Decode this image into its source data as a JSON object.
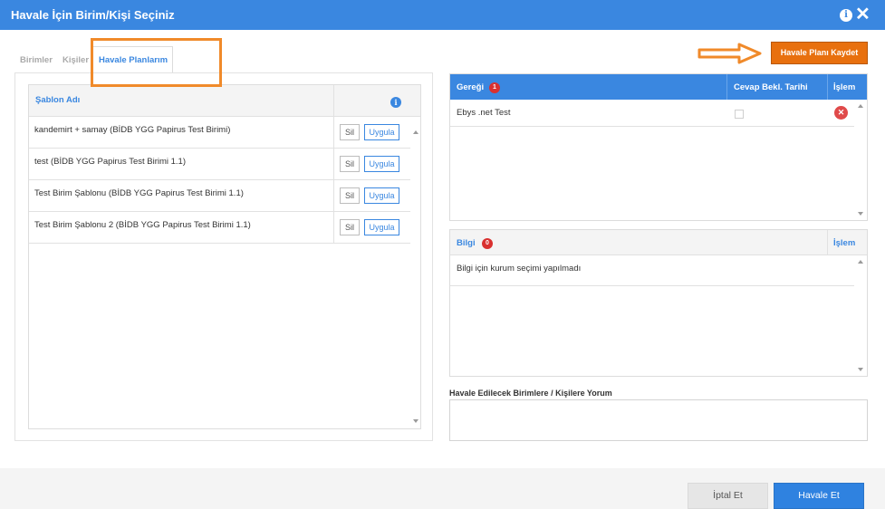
{
  "dialog": {
    "title": "Havale İçin Birim/Kişi Seçiniz",
    "info_icon": "i",
    "close_icon": "✕"
  },
  "tabs": [
    {
      "label": "Birimler",
      "active": false
    },
    {
      "label": "Kişiler",
      "active": false
    },
    {
      "label": "Havale Planlarım",
      "active": true
    }
  ],
  "templates": {
    "header": "Şablon Adı",
    "info_icon": "i",
    "delete_label": "Sil",
    "apply_label": "Uygula",
    "rows": [
      {
        "name": "kandemirt + samay (BİDB YGG Papirus Test Birimi)"
      },
      {
        "name": "test (BİDB YGG Papirus Test Birimi 1.1)"
      },
      {
        "name": "Test Birim Şablonu (BİDB YGG Papirus Test Birimi 1.1)"
      },
      {
        "name": "Test Birim Şablonu 2 (BİDB YGG Papirus Test Birimi 1.1)"
      }
    ]
  },
  "save_plan_button": "Havale Planı Kaydet",
  "geregi": {
    "title": "Gereği",
    "count": "1",
    "col_date": "Cevap Bekl. Tarihi",
    "col_action": "İşlem",
    "rows": [
      {
        "name": "Ebys .net Test",
        "remove_icon": "✕"
      }
    ]
  },
  "bilgi": {
    "title": "Bilgi",
    "count": "0",
    "col_action": "İşlem",
    "empty_message": "Bilgi için kurum seçimi yapılmadı"
  },
  "comment": {
    "label": "Havale Edilecek Birimlere / Kişilere Yorum",
    "value": ""
  },
  "footer": {
    "cancel_label": "İptal Et",
    "submit_label": "Havale Et"
  },
  "colors": {
    "primary": "#3a87e0",
    "accent": "#e8700e",
    "danger": "#d9302f",
    "highlight": "#f08a2a"
  }
}
